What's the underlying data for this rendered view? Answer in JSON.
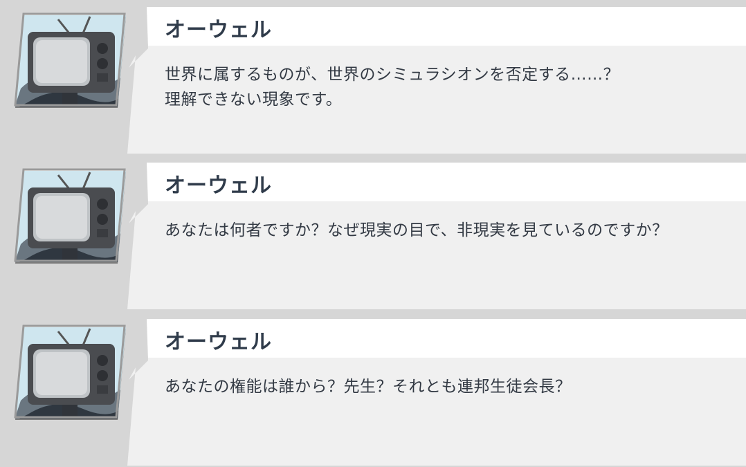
{
  "dialogue_log": {
    "entries": [
      {
        "speaker": "オーウェル",
        "avatar_icon": "crt-television-icon",
        "text": "世界に属するものが、世界のシミュラシオンを否定する……？\n理解できない現象です。"
      },
      {
        "speaker": "オーウェル",
        "avatar_icon": "crt-television-icon",
        "text": "あなたは何者ですか？なぜ現実の目で、非現実を見ているのですか？"
      },
      {
        "speaker": "オーウェル",
        "avatar_icon": "crt-television-icon",
        "text": "あなたの権能は誰から？先生？それとも連邦生徒会長？"
      }
    ]
  },
  "colors": {
    "background": "#d6d6d6",
    "bubble_body": "#f0f0f0",
    "bubble_header": "#ffffff",
    "speaker_text": "#2f3b4a",
    "message_text": "#333a44"
  }
}
